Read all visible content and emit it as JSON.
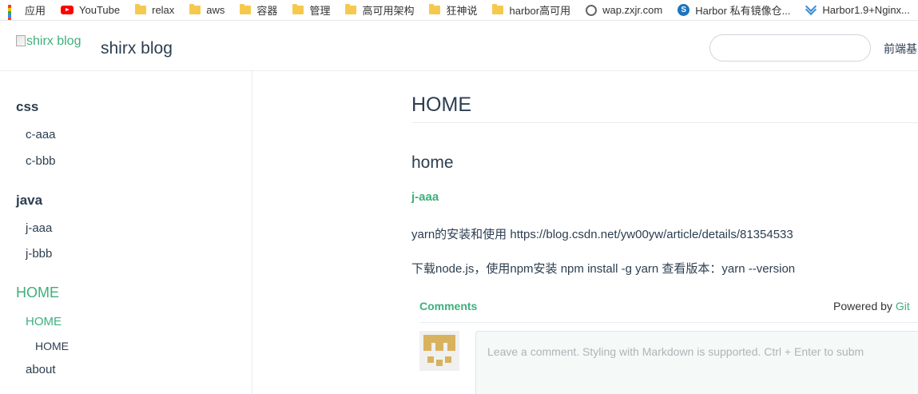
{
  "bookmarks": [
    {
      "label": "应用",
      "icon": "apps-icon"
    },
    {
      "label": "YouTube",
      "icon": "youtube-icon"
    },
    {
      "label": "relax",
      "icon": "folder-icon"
    },
    {
      "label": "aws",
      "icon": "folder-icon"
    },
    {
      "label": "容器",
      "icon": "folder-icon"
    },
    {
      "label": "管理",
      "icon": "folder-icon"
    },
    {
      "label": "高可用架构",
      "icon": "folder-icon"
    },
    {
      "label": "狂神说",
      "icon": "folder-icon"
    },
    {
      "label": "harbor高可用",
      "icon": "folder-icon"
    },
    {
      "label": "wap.zxjr.com",
      "icon": "globe-icon"
    },
    {
      "label": "Harbor 私有镜像仓...",
      "icon": "harbor-site-icon"
    },
    {
      "label": "Harbor1.9+Nginx...",
      "icon": "chevron-site-icon"
    }
  ],
  "navbar": {
    "logo_alt": "shirx blog",
    "site_name": "shirx blog",
    "search_value": "",
    "nav_link": "前端基"
  },
  "sidebar": {
    "groups": [
      {
        "title": "css",
        "items": [
          "c-aaa",
          "c-bbb"
        ]
      },
      {
        "title": "java",
        "items": [
          "j-aaa",
          "j-bbb"
        ]
      },
      {
        "title": "HOME",
        "items": [
          "HOME",
          "about"
        ],
        "subitems": [
          "HOME"
        ]
      }
    ]
  },
  "content": {
    "h1": "HOME",
    "h2": "home",
    "h3": "j-aaa",
    "p1": "yarn的安装和使用 https://blog.csdn.net/yw00yw/article/details/81354533",
    "p2": "下载node.js，使用npm安装 npm install -g yarn 查看版本：yarn --version"
  },
  "comments": {
    "title": "Comments",
    "powered_prefix": "Powered by ",
    "powered_link": "Git",
    "placeholder": "Leave a comment. Styling with Markdown is supported. Ctrl + Enter to subm"
  },
  "colors": {
    "accent": "#3eaf7c",
    "text": "#2c3e50",
    "avatar": "#d9b25e"
  }
}
